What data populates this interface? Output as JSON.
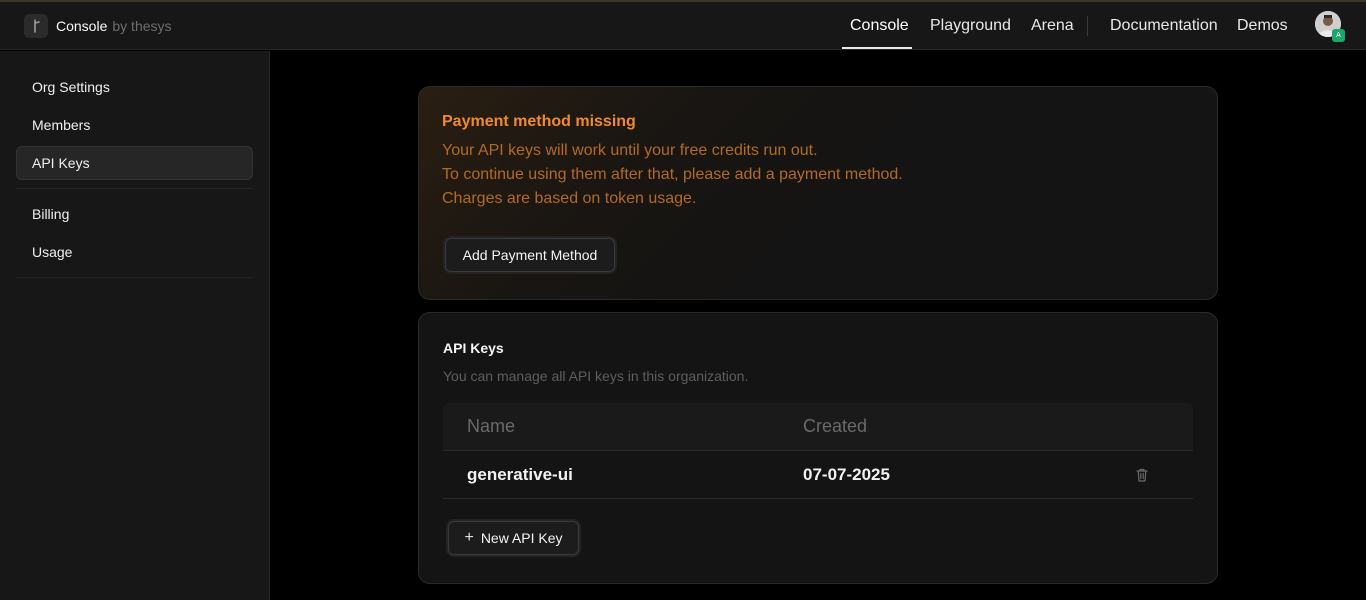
{
  "header": {
    "brand_name": "Console",
    "brand_by": "by thesys",
    "nav": [
      "Console",
      "Playground",
      "Arena",
      "Documentation",
      "Demos"
    ],
    "active_nav": "Console",
    "avatar_badge": "A"
  },
  "sidebar": {
    "items": [
      "Org Settings",
      "Members",
      "API Keys",
      "Billing",
      "Usage"
    ],
    "active": "API Keys"
  },
  "payment_alert": {
    "title": "Payment method missing",
    "lines": [
      "Your API keys will work until your free credits run out.",
      "To continue using them after that, please add a payment method.",
      "Charges are based on token usage."
    ],
    "button": "Add Payment Method"
  },
  "api_keys": {
    "title": "API Keys",
    "subtitle": "You can manage all API keys in this organization.",
    "columns": [
      "Name",
      "Created"
    ],
    "rows": [
      {
        "name": "generative-ui",
        "created": "07-07-2025"
      }
    ],
    "new_button": "New API Key"
  },
  "colors": {
    "accent_warning": "#f08a2e",
    "warning_text": "#b36a26",
    "badge_green": "#1aa76a"
  }
}
